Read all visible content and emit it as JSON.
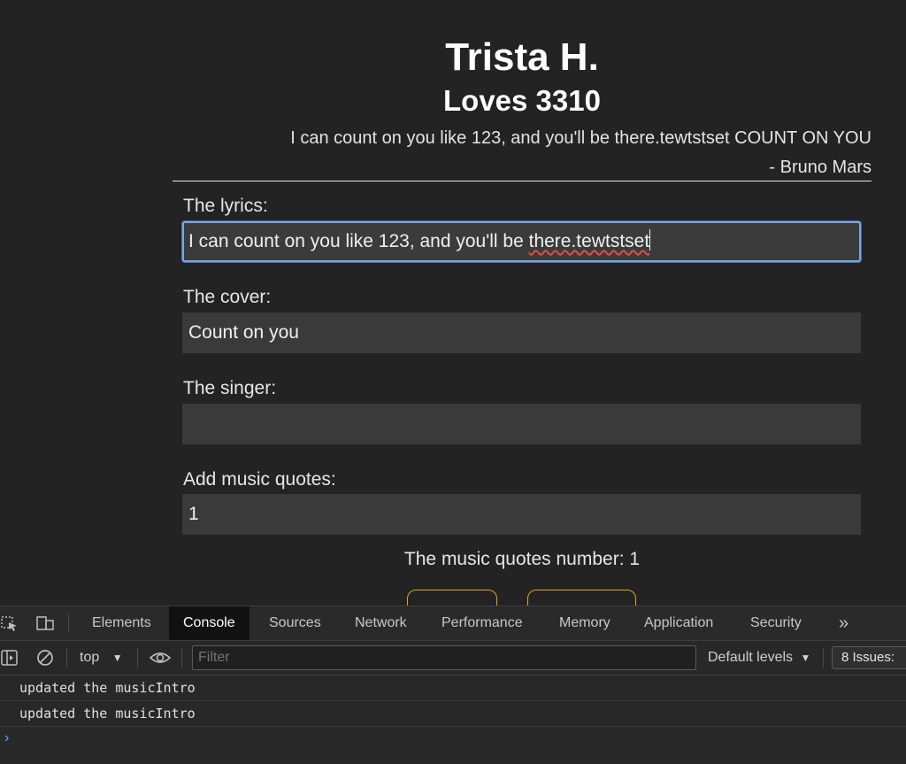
{
  "page": {
    "name": "Trista H.",
    "love_line": "Loves 3310",
    "quote_line": "I can count on you like 123, and you'll be there.tewtstset COUNT ON YOU",
    "quote_author": "- Bruno Mars",
    "lyrics_label": "The lyrics:",
    "lyrics_value_plain": "I can count on you like 123, and you'll be ",
    "lyrics_value_flagged": "there.tewtstset",
    "cover_label": "The cover:",
    "cover_value": "Count on you",
    "singer_label": "The singer:",
    "singer_value": "",
    "quotes_label": "Add music quotes:",
    "quotes_value": "1",
    "quotes_count_text": "The music quotes number: 1"
  },
  "devtools": {
    "tabs": [
      "Elements",
      "Console",
      "Sources",
      "Network",
      "Performance",
      "Memory",
      "Application",
      "Security"
    ],
    "active_tab": "Console",
    "more_tabs": "»",
    "context": "top",
    "filter_placeholder": "Filter",
    "levels": "Default levels",
    "issues": "8 Issues:",
    "logs": [
      "updated the musicIntro",
      "updated the musicIntro"
    ],
    "prompt": "›"
  },
  "colors": {
    "accent_focus": "#7aa6e0",
    "button_border": "#d9a62b",
    "prompt_blue": "#6ea6ff"
  }
}
